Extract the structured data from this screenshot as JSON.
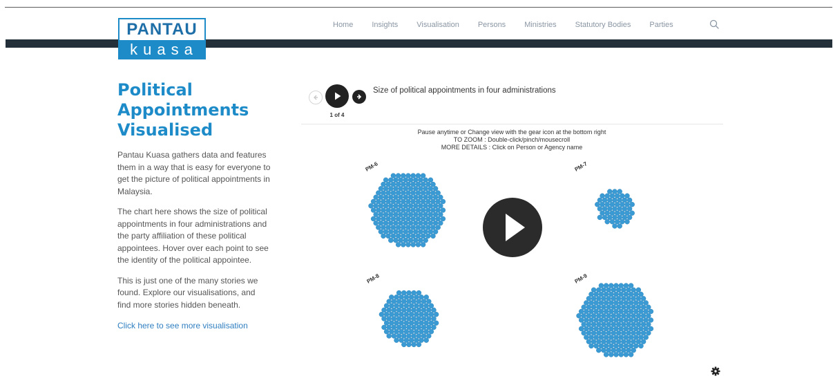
{
  "logo": {
    "line1": "PANTAU",
    "line2": "kuasa"
  },
  "nav": {
    "items": [
      "Home",
      "Insights",
      "Visualisation",
      "Persons",
      "Ministries",
      "Statutory Bodies",
      "Parties"
    ]
  },
  "left": {
    "title": "Political Appointments Visualised",
    "paragraphs": [
      "Pantau Kuasa gathers data and features them in a way that is easy for everyone to get the picture of political appointments in Malaysia.",
      "The chart here shows the size of political appointments in four administrations and the party affiliation of these political appointees. Hover over each point to see the identity of the political appointee.",
      "This is just one of the many stories we found. Explore our visualisations, and find more stories hidden beneath."
    ],
    "link": "Click here to see more visualisation"
  },
  "player": {
    "step": "1 of 4",
    "title": "Size of political appointments in four administrations",
    "instructions": [
      "Pause anytime or Change view with the gear icon at the bottom right",
      "TO ZOOM : Double-click/pinch/mousecroll",
      "MORE DETAILS : Click on Person or Agency name"
    ]
  },
  "colors": {
    "brand": "#1e8bc9",
    "dot": "#3a9ad3",
    "dot_stroke": "#2b7fb5",
    "dark_band": "#243039"
  },
  "chart_data": {
    "type": "scatter",
    "title": "Size of political appointments in four administrations",
    "groups": [
      {
        "name": "PM-6",
        "size": 205
      },
      {
        "name": "PM-7",
        "size": 52
      },
      {
        "name": "PM-8",
        "size": 118
      },
      {
        "name": "PM-9",
        "size": 205
      }
    ]
  }
}
